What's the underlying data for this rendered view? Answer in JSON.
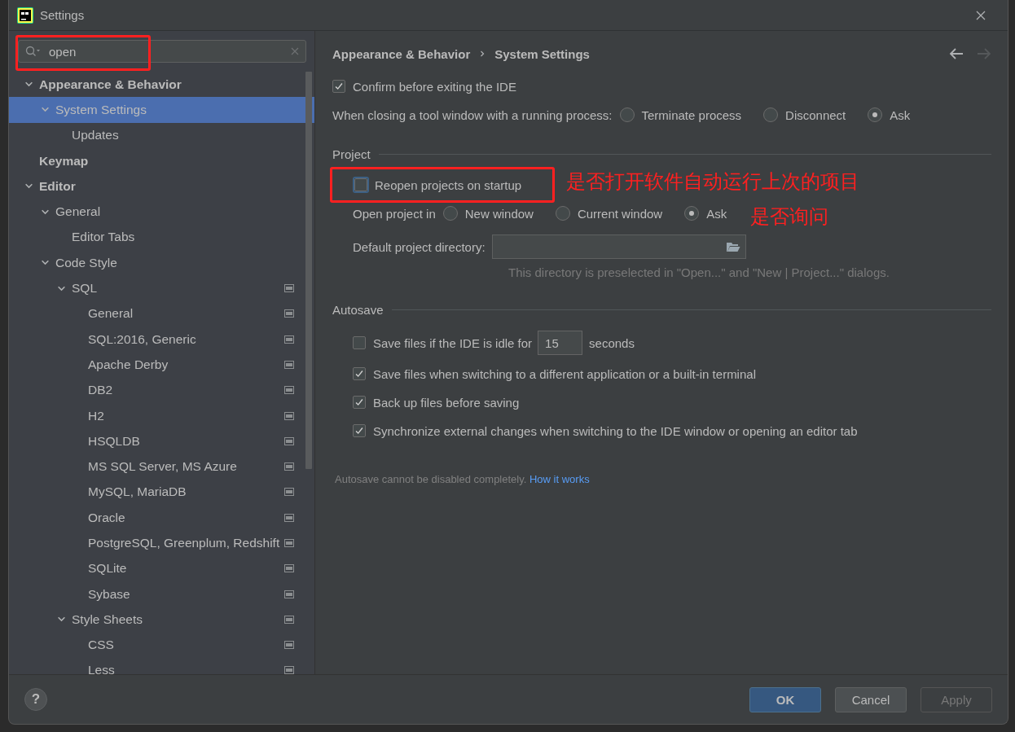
{
  "window": {
    "title": "Settings"
  },
  "search": {
    "value": "open",
    "highlighted": true
  },
  "sidebar": {
    "items": [
      {
        "label": "Appearance & Behavior",
        "selected": false,
        "expanded": true,
        "children": [
          {
            "label": "System Settings",
            "selected": true,
            "expanded": true,
            "children": [
              {
                "label": "Updates",
                "selected": false
              }
            ]
          }
        ]
      },
      {
        "label": "Keymap",
        "selected": false
      },
      {
        "label": "Editor",
        "selected": false,
        "expanded": true,
        "children": [
          {
            "label": "General",
            "selected": false,
            "expanded": true,
            "children": [
              {
                "label": "Editor Tabs",
                "selected": false
              }
            ]
          },
          {
            "label": "Code Style",
            "selected": false,
            "expanded": true,
            "children": [
              {
                "label": "SQL",
                "selected": false,
                "expanded": true,
                "scheme_icon": true,
                "children": [
                  {
                    "label": "General",
                    "selected": false,
                    "scheme_icon": true
                  },
                  {
                    "label": "SQL:2016, Generic",
                    "selected": false,
                    "scheme_icon": true
                  },
                  {
                    "label": "Apache Derby",
                    "selected": false,
                    "scheme_icon": true
                  },
                  {
                    "label": "DB2",
                    "selected": false,
                    "scheme_icon": true
                  },
                  {
                    "label": "H2",
                    "selected": false,
                    "scheme_icon": true
                  },
                  {
                    "label": "HSQLDB",
                    "selected": false,
                    "scheme_icon": true
                  },
                  {
                    "label": "MS SQL Server, MS Azure",
                    "selected": false,
                    "scheme_icon": true
                  },
                  {
                    "label": "MySQL, MariaDB",
                    "selected": false,
                    "scheme_icon": true
                  },
                  {
                    "label": "Oracle",
                    "selected": false,
                    "scheme_icon": true
                  },
                  {
                    "label": "PostgreSQL, Greenplum, Redshift",
                    "selected": false,
                    "scheme_icon": true
                  },
                  {
                    "label": "SQLite",
                    "selected": false,
                    "scheme_icon": true
                  },
                  {
                    "label": "Sybase",
                    "selected": false,
                    "scheme_icon": true
                  }
                ]
              },
              {
                "label": "Style Sheets",
                "selected": false,
                "expanded": true,
                "scheme_icon": true,
                "children": [
                  {
                    "label": "CSS",
                    "selected": false,
                    "scheme_icon": true
                  },
                  {
                    "label": "Less",
                    "selected": false,
                    "scheme_icon": true
                  }
                ]
              }
            ]
          }
        ]
      }
    ]
  },
  "breadcrumb": [
    "Appearance & Behavior",
    "System Settings"
  ],
  "navigation": {
    "back_enabled": true,
    "forward_enabled": false
  },
  "general": {
    "confirm_exit": {
      "label": "Confirm before exiting the IDE",
      "checked": true
    },
    "tool_window": {
      "label": "When closing a tool window with a running process:",
      "options": [
        {
          "label": "Terminate process",
          "selected": false
        },
        {
          "label": "Disconnect",
          "selected": false
        },
        {
          "label": "Ask",
          "selected": true
        }
      ]
    }
  },
  "project": {
    "title": "Project",
    "reopen": {
      "label": "Reopen projects on startup",
      "checked": false,
      "focused": true,
      "highlighted": true
    },
    "open_in": {
      "label": "Open project in",
      "options": [
        {
          "label": "New window",
          "selected": false
        },
        {
          "label": "Current window",
          "selected": false
        },
        {
          "label": "Ask",
          "selected": true
        }
      ]
    },
    "directory": {
      "label": "Default project directory:"
    },
    "hint": "This directory is preselected in \"Open...\" and \"New | Project...\" dialogs."
  },
  "autosave": {
    "title": "Autosave",
    "items": [
      {
        "kind": "idle",
        "label": "Save files if the IDE is idle for",
        "checked": false,
        "value": "15",
        "suffix": "seconds"
      },
      {
        "kind": "plain",
        "label": "Save files when switching to a different application or a built-in terminal",
        "checked": true
      },
      {
        "kind": "plain",
        "label": "Back up files before saving",
        "checked": true
      },
      {
        "kind": "plain",
        "label": "Synchronize external changes when switching to the IDE window or opening an editor tab",
        "checked": true
      }
    ],
    "note": "Autosave cannot be disabled completely.",
    "link": "How it works"
  },
  "help_button": "?",
  "buttons": [
    {
      "label": "OK",
      "primary": true,
      "disabled": false
    },
    {
      "label": "Cancel",
      "primary": false,
      "disabled": false
    },
    {
      "label": "Apply",
      "primary": false,
      "disabled": true
    }
  ],
  "annotations": [
    {
      "text": "是否打开软件自动运行上次的项目"
    },
    {
      "text": "是否询问"
    }
  ]
}
